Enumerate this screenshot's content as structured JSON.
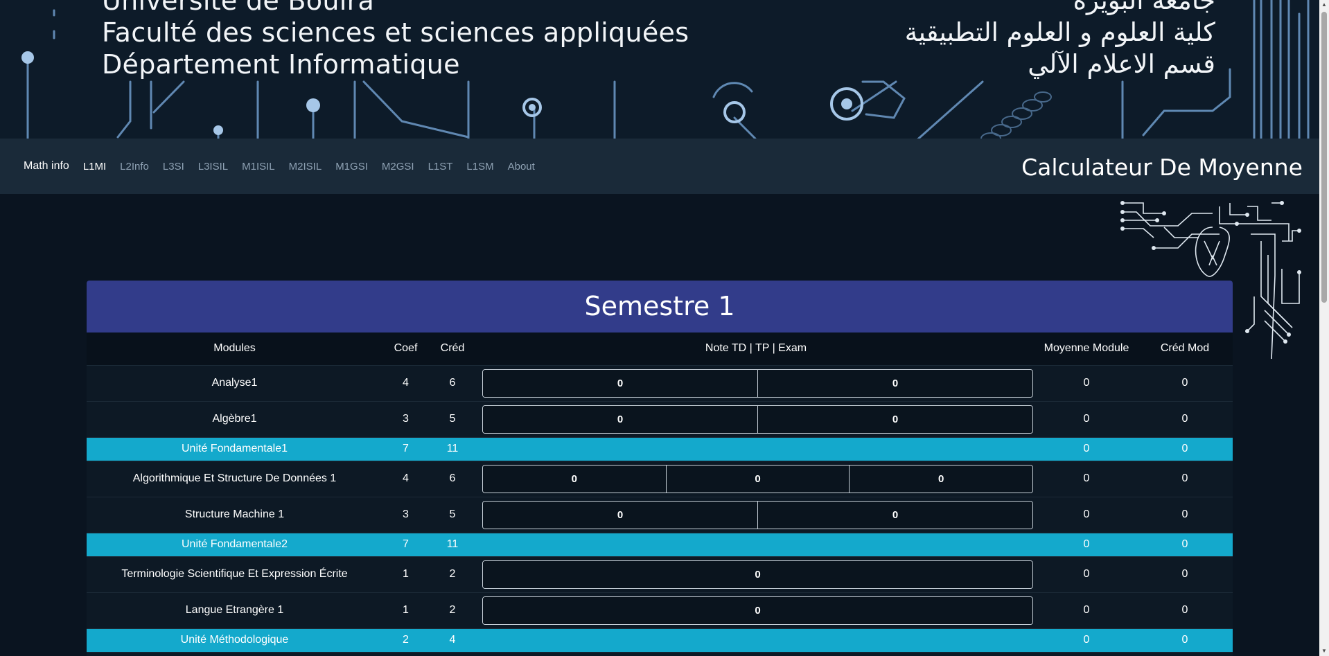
{
  "header": {
    "fr_lines": [
      "Université de Bouira",
      "Faculté des sciences et sciences appliquées",
      "Département Informatique"
    ],
    "ar_lines": [
      "جامعة البويرة",
      "كلية العلوم و العلوم التطبيقية",
      "قسم الاعلام الآلي"
    ]
  },
  "nav": {
    "brand": "Math info",
    "links": [
      "L1MI",
      "L2Info",
      "L3SI",
      "L3ISIL",
      "M1ISIL",
      "M2ISIL",
      "M1GSI",
      "M2GSI",
      "L1ST",
      "L1SM",
      "About"
    ],
    "active": "L1MI",
    "title": "Calculateur De Moyenne"
  },
  "semester": {
    "title": "Semestre 1",
    "columns": [
      "Modules",
      "Coef",
      "Créd",
      "Note TD | TP | Exam",
      "Moyenne Module",
      "Créd Mod"
    ],
    "rows": [
      {
        "type": "module",
        "name": "Analyse1",
        "coef": "4",
        "cred": "6",
        "notes": [
          "0",
          "0"
        ],
        "moyenne": "0",
        "cred_mod": "0"
      },
      {
        "type": "module",
        "name": "Algèbre1",
        "coef": "3",
        "cred": "5",
        "notes": [
          "0",
          "0"
        ],
        "moyenne": "0",
        "cred_mod": "0"
      },
      {
        "type": "unit",
        "name": "Unité Fondamentale1",
        "coef": "7",
        "cred": "11",
        "moyenne": "0",
        "cred_mod": "0"
      },
      {
        "type": "module",
        "name": "Algorithmique Et Structure De Données 1",
        "coef": "4",
        "cred": "6",
        "notes": [
          "0",
          "0",
          "0"
        ],
        "moyenne": "0",
        "cred_mod": "0"
      },
      {
        "type": "module",
        "name": "Structure Machine 1",
        "coef": "3",
        "cred": "5",
        "notes": [
          "0",
          "0"
        ],
        "moyenne": "0",
        "cred_mod": "0"
      },
      {
        "type": "unit",
        "name": "Unité Fondamentale2",
        "coef": "7",
        "cred": "11",
        "moyenne": "0",
        "cred_mod": "0"
      },
      {
        "type": "module",
        "name": "Terminologie Scientifique Et Expression Écrite",
        "coef": "1",
        "cred": "2",
        "notes": [
          "0"
        ],
        "moyenne": "0",
        "cred_mod": "0"
      },
      {
        "type": "module",
        "name": "Langue Etrangère 1",
        "coef": "1",
        "cred": "2",
        "notes": [
          "0"
        ],
        "moyenne": "0",
        "cred_mod": "0"
      },
      {
        "type": "unit",
        "name": "Unité Méthodologique",
        "coef": "2",
        "cred": "4",
        "moyenne": "0",
        "cred_mod": "0"
      }
    ]
  },
  "colors": {
    "background": "#0a1420",
    "semester_header": "#323c8a",
    "unit_row": "#14a9cc"
  }
}
